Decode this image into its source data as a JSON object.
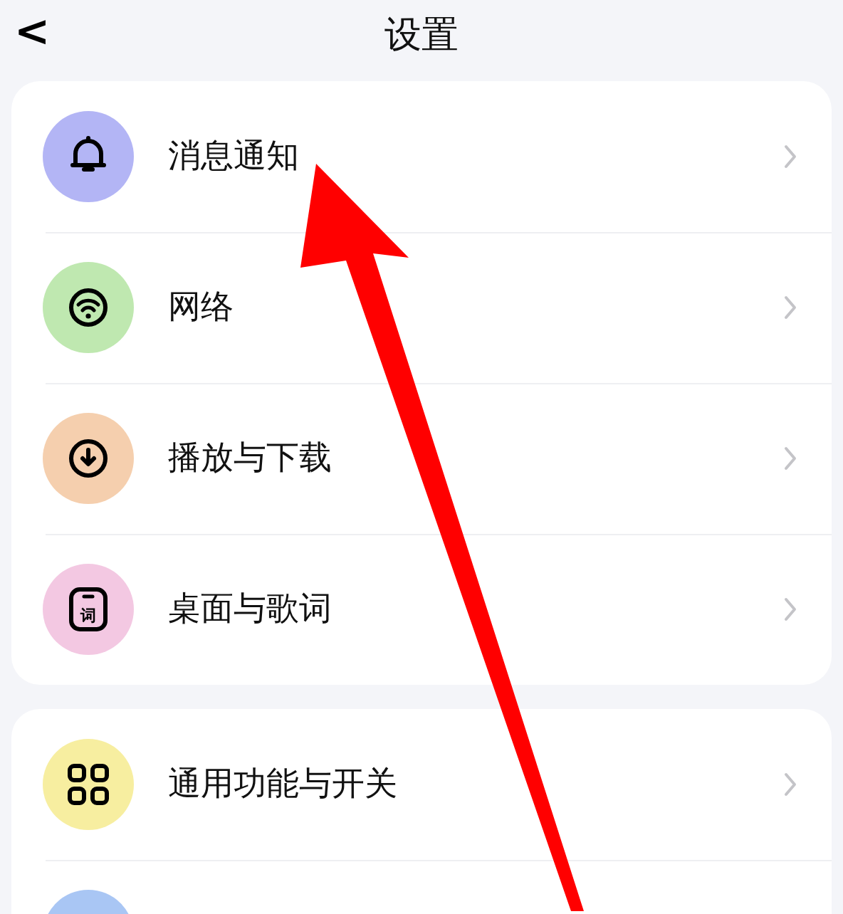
{
  "header": {
    "back": "<",
    "title": "设置"
  },
  "groups": [
    {
      "items": [
        {
          "kind": "bell",
          "color": "#b3b5f5",
          "label": "消息通知"
        },
        {
          "kind": "wifi",
          "color": "#bfe8b0",
          "label": "网络"
        },
        {
          "kind": "download",
          "color": "#f5cfae",
          "label": "播放与下载"
        },
        {
          "kind": "lyrics",
          "color": "#f3c8e2",
          "label": "桌面与歌词",
          "badge": "词"
        }
      ]
    },
    {
      "items": [
        {
          "kind": "grid",
          "color": "#f7eea0",
          "label": "通用功能与开关"
        },
        {
          "kind": "blank",
          "color": "#a9c6f4"
        }
      ]
    }
  ]
}
